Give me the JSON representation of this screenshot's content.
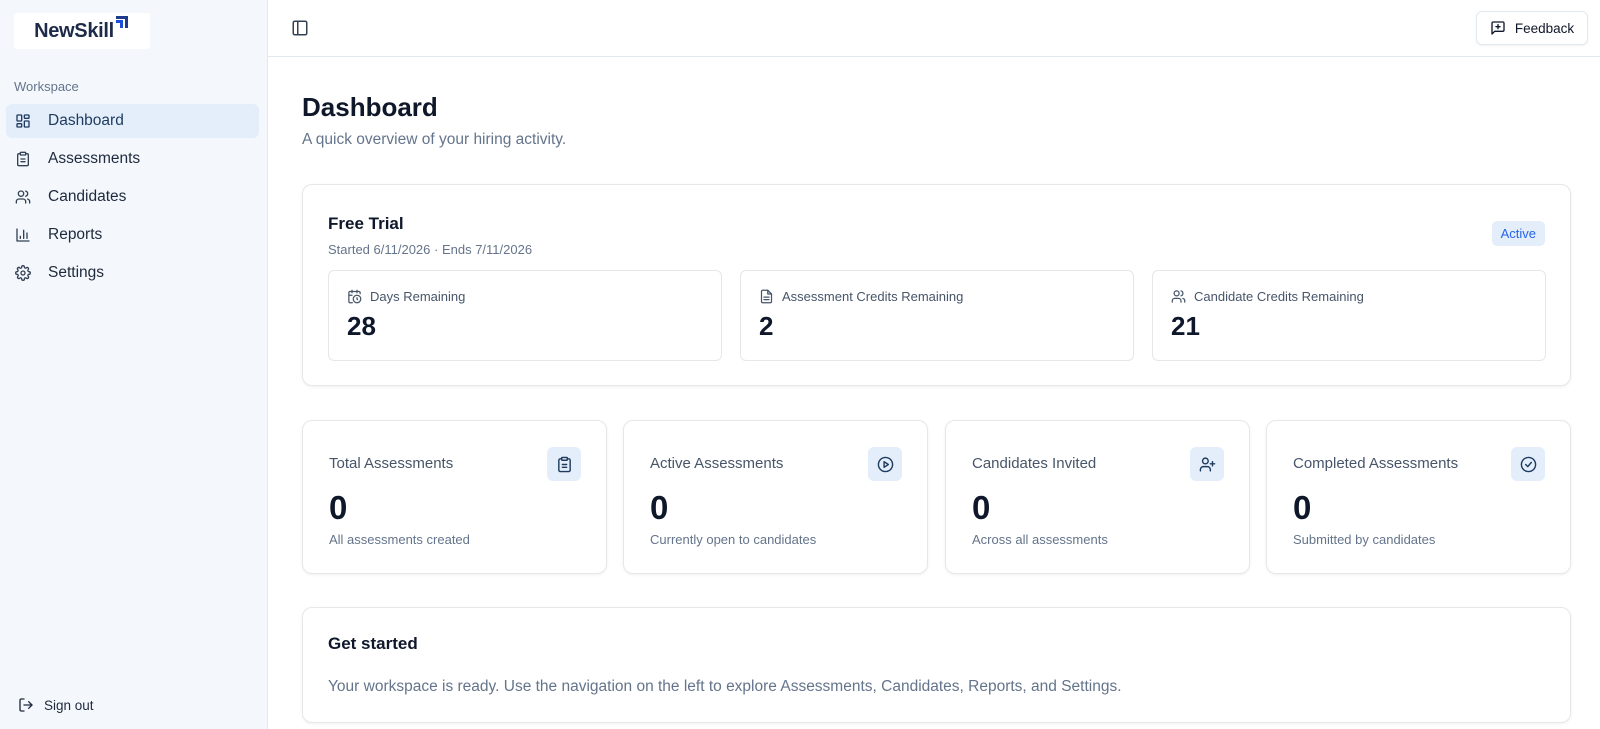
{
  "app": {
    "logo_text": "NewSkill"
  },
  "sidebar": {
    "section_label": "Workspace",
    "items": [
      {
        "label": "Dashboard",
        "icon": "dashboard-icon",
        "active": true
      },
      {
        "label": "Assessments",
        "icon": "clipboard-icon",
        "active": false
      },
      {
        "label": "Candidates",
        "icon": "users-icon",
        "active": false
      },
      {
        "label": "Reports",
        "icon": "bar-chart-icon",
        "active": false
      },
      {
        "label": "Settings",
        "icon": "gear-icon",
        "active": false
      }
    ],
    "signout_label": "Sign out"
  },
  "topbar": {
    "feedback_label": "Feedback"
  },
  "page": {
    "title": "Dashboard",
    "subtitle": "A quick overview of your hiring activity."
  },
  "trial": {
    "title": "Free Trial",
    "dates": "Started 6/11/2026 · Ends 7/11/2026",
    "status": "Active",
    "stats": [
      {
        "label": "Days Remaining",
        "value": "28",
        "icon": "calendar-clock-icon"
      },
      {
        "label": "Assessment Credits Remaining",
        "value": "2",
        "icon": "document-icon"
      },
      {
        "label": "Candidate Credits Remaining",
        "value": "21",
        "icon": "users-icon"
      }
    ]
  },
  "metrics": [
    {
      "title": "Total Assessments",
      "value": "0",
      "desc": "All assessments created",
      "icon": "clipboard-icon"
    },
    {
      "title": "Active Assessments",
      "value": "0",
      "desc": "Currently open to candidates",
      "icon": "play-circle-icon"
    },
    {
      "title": "Candidates Invited",
      "value": "0",
      "desc": "Across all assessments",
      "icon": "user-plus-icon"
    },
    {
      "title": "Completed Assessments",
      "value": "0",
      "desc": "Submitted by candidates",
      "icon": "check-circle-icon"
    }
  ],
  "get_started": {
    "title": "Get started",
    "body": "Your workspace is ready. Use the navigation on the left to explore Assessments, Candidates, Reports, and Settings."
  },
  "colors": {
    "sidebar_bg": "#f4f8fd",
    "active_bg": "#e3eefa",
    "badge_text": "#2563eb",
    "brand_navy": "#1e2a4a",
    "brand_blue": "#1d4ed8"
  }
}
